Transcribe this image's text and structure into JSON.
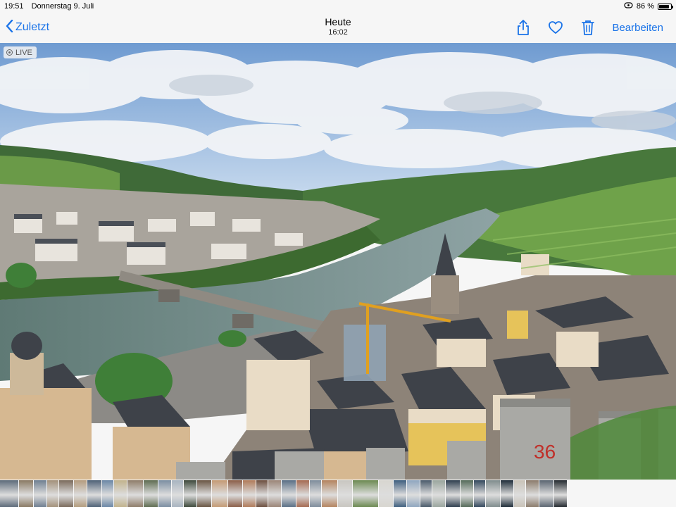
{
  "status_bar": {
    "time": "19:51",
    "date": "Donnerstag 9. Juli",
    "battery": "86 %",
    "battery_level": 0.86
  },
  "nav": {
    "back_label": "Zuletzt",
    "title": "Heute",
    "subtitle": "16:02",
    "edit_label": "Bearbeiten",
    "accent_color": "#1a73e8",
    "icons": [
      "share-icon",
      "heart-icon",
      "trash-icon"
    ]
  },
  "photo": {
    "live_label": "LIVE",
    "sign_text": "36"
  },
  "filmstrip": {
    "thumbnails": [
      {
        "w": 26,
        "c": "#5d6b7a"
      },
      {
        "w": 20,
        "c": "#8a7a64"
      },
      {
        "w": 18,
        "c": "#6f7f91"
      },
      {
        "w": 16,
        "c": "#a3917a"
      },
      {
        "w": 20,
        "c": "#7b6b5c"
      },
      {
        "w": 18,
        "c": "#b49c7e"
      },
      {
        "w": 20,
        "c": "#4f6277"
      },
      {
        "w": 16,
        "c": "#6b87a6"
      },
      {
        "w": 18,
        "c": "#c2b38d"
      },
      {
        "w": 22,
        "c": "#8f7d6a"
      },
      {
        "w": 20,
        "c": "#5f6d52"
      },
      {
        "w": 18,
        "c": "#7b8ea2"
      },
      {
        "w": 16,
        "c": "#a8b4c0"
      },
      {
        "w": 18,
        "c": "#3e4a3c"
      },
      {
        "w": 20,
        "c": "#6a5644"
      },
      {
        "w": 22,
        "c": "#c49a74"
      },
      {
        "w": 20,
        "c": "#8b5e48"
      },
      {
        "w": 18,
        "c": "#b07b5a"
      },
      {
        "w": 16,
        "c": "#6d4f3f"
      },
      {
        "w": 18,
        "c": "#9b8577"
      },
      {
        "w": 20,
        "c": "#5a6f86"
      },
      {
        "w": 18,
        "c": "#a56a52"
      },
      {
        "w": 16,
        "c": "#7e8c9b"
      },
      {
        "w": 22,
        "c": "#b4845f"
      },
      {
        "w": 20,
        "c": "#c8c6c0"
      },
      {
        "w": 36,
        "c": "#6c8a52"
      },
      {
        "w": 20,
        "c": "#d8d6d0"
      },
      {
        "w": 18,
        "c": "#3f5f7f"
      },
      {
        "w": 18,
        "c": "#8fa6bf"
      },
      {
        "w": 16,
        "c": "#4b5b6b"
      },
      {
        "w": 18,
        "c": "#9aa69e"
      },
      {
        "w": 20,
        "c": "#2f3f4f"
      },
      {
        "w": 18,
        "c": "#556b5a"
      },
      {
        "w": 16,
        "c": "#34495e"
      },
      {
        "w": 20,
        "c": "#7f8c8d"
      },
      {
        "w": 18,
        "c": "#1f2d3a"
      },
      {
        "w": 16,
        "c": "#c9c3b8"
      },
      {
        "w": 18,
        "c": "#8c7c6c"
      },
      {
        "w": 20,
        "c": "#5b6571"
      },
      {
        "w": 18,
        "c": "#242a30"
      }
    ]
  }
}
